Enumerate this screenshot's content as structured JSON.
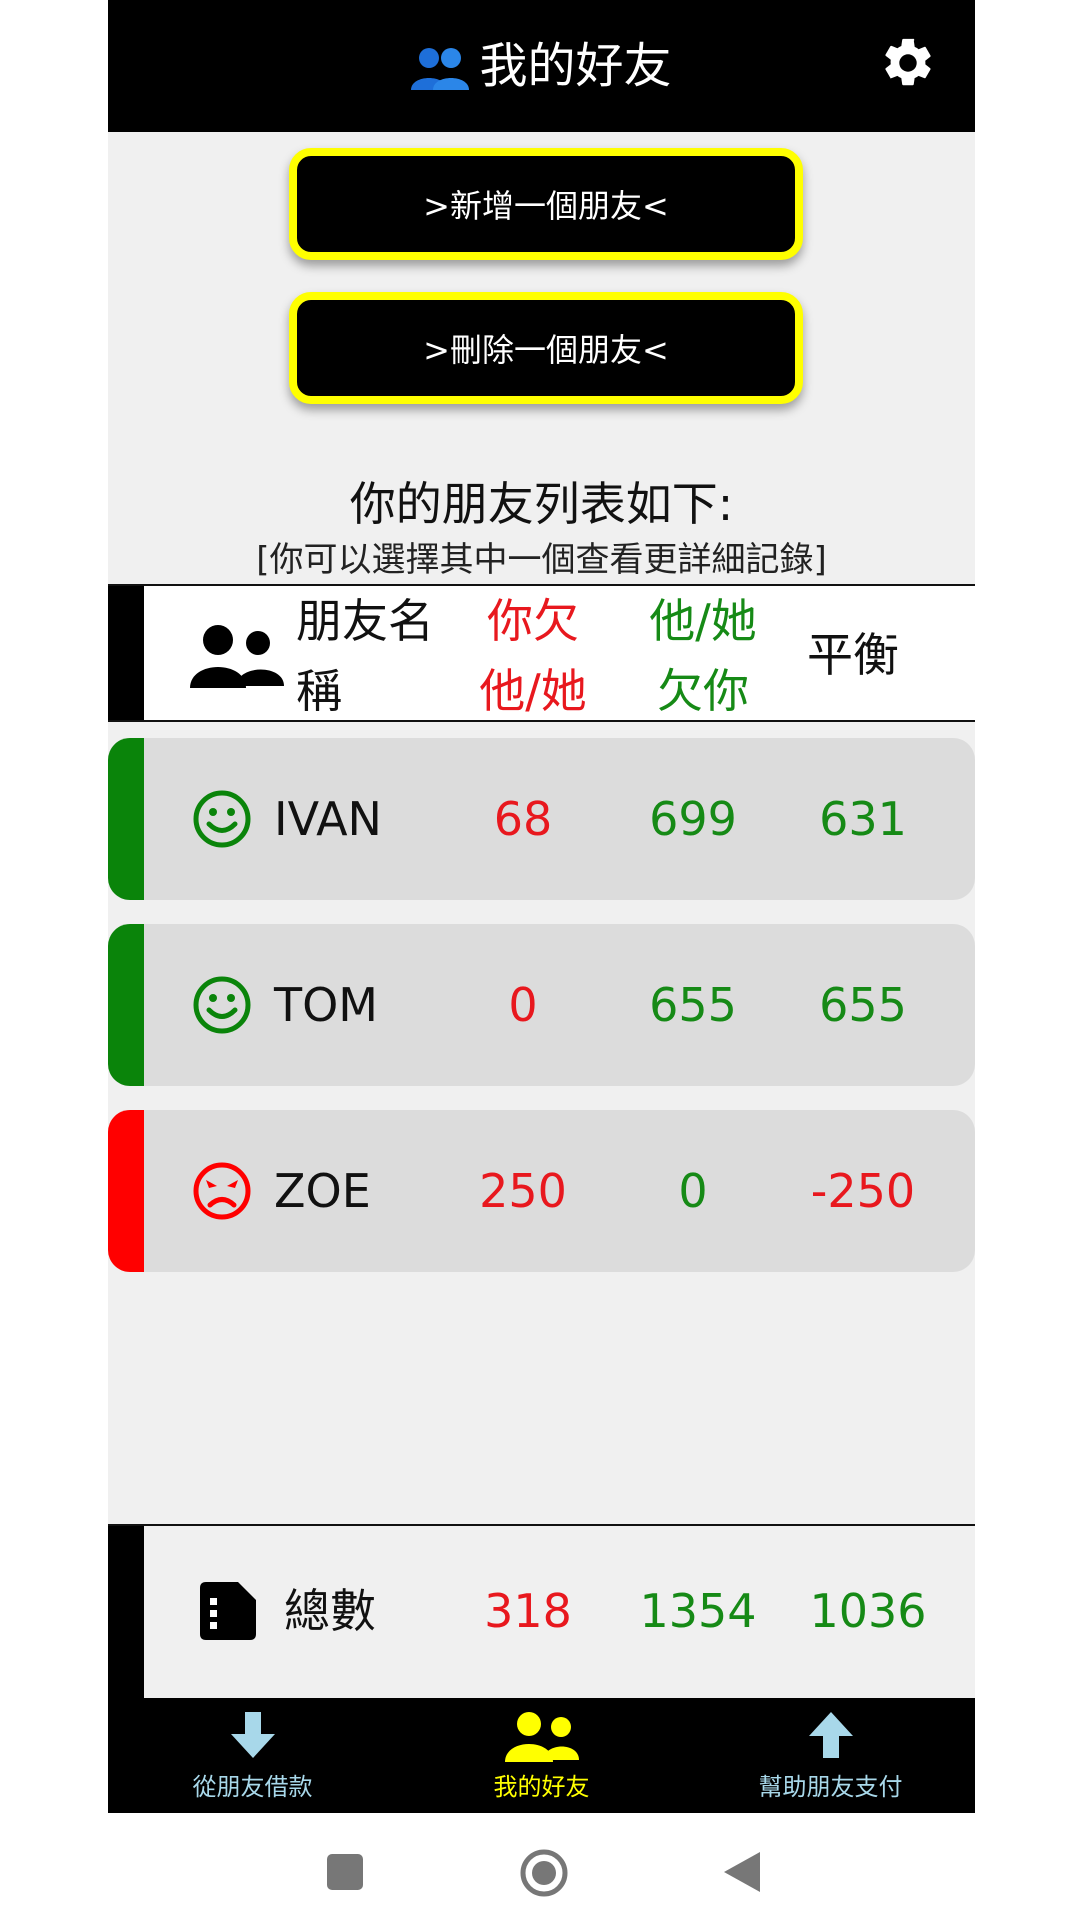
{
  "header": {
    "title": "我的好友",
    "title_icon": "people-icon",
    "settings_icon": "gear-icon"
  },
  "actions": {
    "add_friend": ">新增一個朋友<",
    "delete_friend": ">刪除一個朋友<"
  },
  "list": {
    "title": "你的朋友列表如下:",
    "subtitle": "[你可以選擇其中一個查看更詳細記錄]"
  },
  "columns": {
    "name_line1": "朋友名",
    "name_line2": "稱",
    "owe_line1": "你欠",
    "owe_line2": "他/她",
    "owed_line1": "他/她",
    "owed_line2": "欠你",
    "balance": "平衡"
  },
  "friends": [
    {
      "name": "IVAN",
      "you_owe": "68",
      "they_owe": "699",
      "balance": "631",
      "status": "happy",
      "color": "#0a840a"
    },
    {
      "name": "TOM",
      "you_owe": "0",
      "they_owe": "655",
      "balance": "655",
      "status": "happy",
      "color": "#0a840a"
    },
    {
      "name": "ZOE",
      "you_owe": "250",
      "they_owe": "0",
      "balance": "-250",
      "status": "angry",
      "color": "#ff0000"
    }
  ],
  "totals": {
    "label": "總數",
    "you_owe": "318",
    "they_owe": "1354",
    "balance": "1036"
  },
  "nav": {
    "items": [
      {
        "label": "從朋友借款",
        "icon": "arrow-down-icon",
        "color": "#a8d8ea"
      },
      {
        "label": "我的好友",
        "icon": "people-icon",
        "color": "#ffff00",
        "active": true
      },
      {
        "label": "幫助朋友支付",
        "icon": "arrow-up-icon",
        "color": "#a8d8ea"
      }
    ]
  },
  "system_nav": {
    "items": [
      "recent-apps-icon",
      "home-icon",
      "back-icon"
    ]
  },
  "colors": {
    "accent": "#ffff00",
    "red": "#e8181e",
    "green": "#168a16",
    "bar_black": "#000000"
  }
}
